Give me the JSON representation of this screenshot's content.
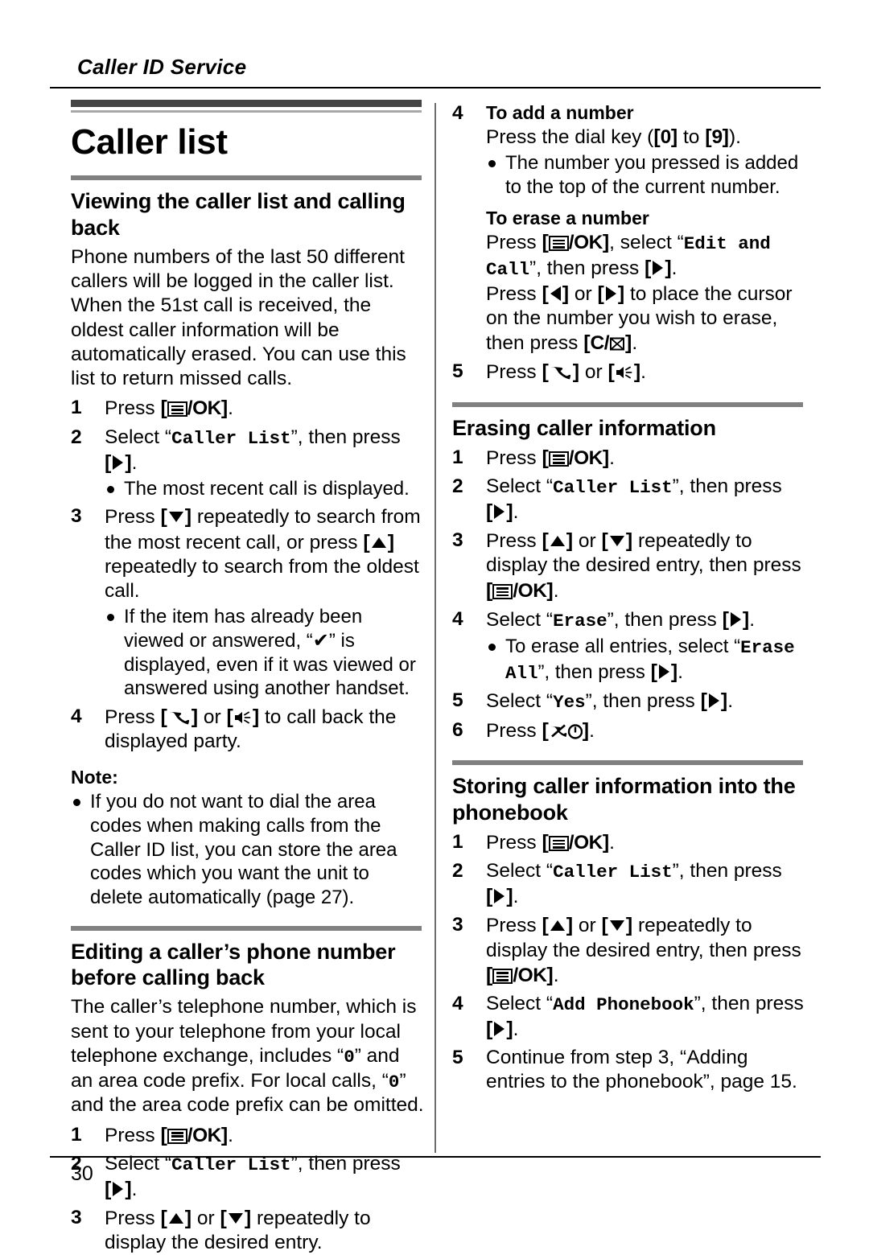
{
  "running_head": "Caller ID Service",
  "folio": "30",
  "chapter_title": "Caller list",
  "icons": {
    "menu_ok": "menu-ok-key-icon",
    "right": "right-arrow-key-icon",
    "left": "left-arrow-key-icon",
    "up": "up-arrow-key-icon",
    "down": "down-arrow-key-icon",
    "talk": "talk-handset-key-icon",
    "speaker": "speakerphone-key-icon",
    "clear": "clear-backspace-key-icon",
    "off": "power-off-key-icon",
    "check": "checkmark-icon"
  },
  "left_column": {
    "section1": {
      "heading": "Viewing the caller list and calling back",
      "intro": "Phone numbers of the last 50 different callers will be logged in the caller list. When the 51st call is received, the oldest caller information will be automatically erased. You can use this list to return missed calls.",
      "steps": [
        {
          "num": "1",
          "pre": "Press ",
          "key": "menu_ok",
          "post": "."
        },
        {
          "num": "2",
          "pre": "Select ",
          "quoted": "Caller List",
          "mid": ", then press ",
          "key": "right",
          "post": ".",
          "bullets": [
            "The most recent call is displayed."
          ]
        },
        {
          "num": "3",
          "pre": "Press ",
          "key": "down",
          "mid": " repeatedly to search from the most recent call, or press ",
          "key2": "up",
          "post": " repeatedly to search from the oldest call.",
          "bullets": [
            "If the item has already been viewed or answered, “✔” is displayed, even if it was viewed or answered using another handset."
          ]
        },
        {
          "num": "4",
          "pre": "Press ",
          "key": "talk",
          "mid": " or ",
          "key2": "speaker",
          "post": " to call back the displayed party."
        }
      ],
      "note_label": "Note:",
      "note_bullets": [
        "If you do not want to dial the area codes when making calls from the Caller ID list, you can store the area codes which you want the unit to delete automatically (page 27)."
      ]
    },
    "section2": {
      "heading": "Editing a caller’s phone number before calling back",
      "intro_a": "The caller’s telephone number, which is sent to your telephone from your local telephone exchange, includes ",
      "intro_quote1": "0",
      "intro_b": " and an area code prefix. For local calls, ",
      "intro_quote2": "0",
      "intro_c": " and the area code prefix can be omitted.",
      "steps": [
        {
          "num": "1",
          "pre": "Press ",
          "key": "menu_ok",
          "post": "."
        },
        {
          "num": "2",
          "pre": "Select ",
          "quoted": "Caller List",
          "mid": ", then press ",
          "key": "right",
          "post": "."
        },
        {
          "num": "3",
          "pre": "Press ",
          "key": "up",
          "mid": " or ",
          "key2": "down",
          "post": " repeatedly to display the desired entry."
        }
      ]
    }
  },
  "right_column": {
    "continued": {
      "step4": {
        "num": "4",
        "bold_heading": "To add a number",
        "line1_pre": "Press the dial key (",
        "key_0": "0",
        "line1_mid": " to ",
        "key_9": "9",
        "line1_post": ").",
        "bullets": [
          "The number you pressed is added to the top of the current number."
        ],
        "sub_heading": "To erase a number",
        "erase_l1_pre": "Press ",
        "erase_l1_mid": ", select ",
        "erase_quote": "Edit and Call",
        "erase_l1_post": ", then press ",
        "erase_l1_end": ".",
        "erase_l2_pre": "Press ",
        "erase_l2_mid": " or ",
        "erase_l2_post": " to place the cursor on the number you wish to erase, then press ",
        "erase_l2_end": "."
      },
      "step5": {
        "num": "5",
        "pre": "Press ",
        "key": "talk",
        "mid": " or ",
        "key2": "speaker",
        "post": "."
      }
    },
    "section_erase": {
      "heading": "Erasing caller information",
      "steps": [
        {
          "num": "1",
          "pre": "Press ",
          "key": "menu_ok",
          "post": "."
        },
        {
          "num": "2",
          "pre": "Select ",
          "quoted": "Caller List",
          "mid": ", then press ",
          "key": "right",
          "post": "."
        },
        {
          "num": "3",
          "pre": "Press ",
          "key": "up",
          "mid": " or ",
          "key2": "down",
          "post": " repeatedly to display the desired entry, then press ",
          "key3": "menu_ok",
          "end": "."
        },
        {
          "num": "4",
          "pre": "Select ",
          "quoted": "Erase",
          "mid": ", then press ",
          "key": "right",
          "post": ".",
          "bullets_rich": {
            "pre": "To erase all entries, select ",
            "quoted": "Erase All",
            "mid": ", then press ",
            "key": "right",
            "post": "."
          }
        },
        {
          "num": "5",
          "pre": "Select ",
          "quoted": "Yes",
          "mid": ", then press ",
          "key": "right",
          "post": "."
        },
        {
          "num": "6",
          "pre": "Press ",
          "key": "off",
          "post": "."
        }
      ]
    },
    "section_store": {
      "heading": "Storing caller information into the phonebook",
      "steps": [
        {
          "num": "1",
          "pre": "Press ",
          "key": "menu_ok",
          "post": "."
        },
        {
          "num": "2",
          "pre": "Select ",
          "quoted": "Caller List",
          "mid": ", then press ",
          "key": "right",
          "post": "."
        },
        {
          "num": "3",
          "pre": "Press ",
          "key": "up",
          "mid": " or ",
          "key2": "down",
          "post": " repeatedly to display the desired entry, then press ",
          "key3": "menu_ok",
          "end": "."
        },
        {
          "num": "4",
          "pre": "Select ",
          "quoted": "Add Phonebook",
          "mid": ", then press ",
          "key": "right",
          "post": "."
        },
        {
          "num": "5",
          "text": "Continue from step 3, “Adding entries to the phonebook”, page 15."
        }
      ]
    }
  }
}
